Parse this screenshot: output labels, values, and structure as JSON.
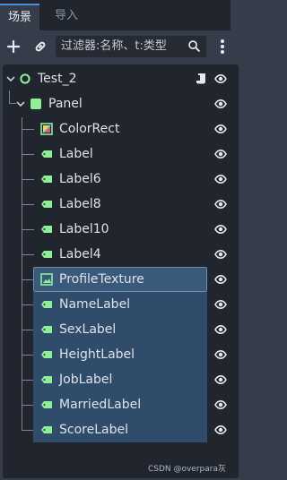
{
  "tabs": [
    {
      "label": "场景",
      "active": true
    },
    {
      "label": "导入",
      "active": false
    }
  ],
  "toolbar": {
    "filter_value": "过滤器:名称、t:类型"
  },
  "tree": {
    "root": {
      "label": "Test_2",
      "icon": "node-circle-icon",
      "has_script": true
    },
    "panel": {
      "label": "Panel",
      "icon": "panel-icon"
    },
    "children": [
      {
        "label": "ColorRect",
        "icon": "colorrect-icon",
        "selected": false
      },
      {
        "label": "Label",
        "icon": "label-icon",
        "selected": false
      },
      {
        "label": "Label6",
        "icon": "label-icon",
        "selected": false
      },
      {
        "label": "Label8",
        "icon": "label-icon",
        "selected": false
      },
      {
        "label": "Label10",
        "icon": "label-icon",
        "selected": false
      },
      {
        "label": "Label4",
        "icon": "label-icon",
        "selected": false
      },
      {
        "label": "ProfileTexture",
        "icon": "texture-rect-icon",
        "selected": true,
        "focused": true
      },
      {
        "label": "NameLabel",
        "icon": "label-icon",
        "selected": true
      },
      {
        "label": "SexLabel",
        "icon": "label-icon",
        "selected": true
      },
      {
        "label": "HeightLabel",
        "icon": "label-icon",
        "selected": true
      },
      {
        "label": "JobLabel",
        "icon": "label-icon",
        "selected": true
      },
      {
        "label": "MarriedLabel",
        "icon": "label-icon",
        "selected": true
      },
      {
        "label": "ScoreLabel",
        "icon": "label-icon",
        "selected": true
      }
    ]
  },
  "colors": {
    "accent": "#4a90e2",
    "node_green": "#8eef97",
    "selection": "#2f4c6b"
  },
  "watermark": "CSDN @overpara灰"
}
